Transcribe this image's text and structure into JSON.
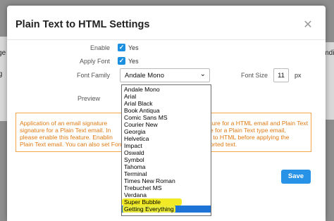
{
  "background": {
    "left_labels": [
      "ange",
      "ing"
    ],
    "right_label": "rmdi"
  },
  "modal": {
    "title": "Plain Text to HTML Settings",
    "close_icon": "close-icon",
    "enable": {
      "label": "Enable",
      "checkbox_label": "Yes",
      "checked": true
    },
    "apply_font": {
      "label": "Apply Font",
      "checkbox_label": "Yes",
      "checked": true
    },
    "font_family": {
      "label": "Font Family",
      "value": "Andale Mono"
    },
    "font_size": {
      "label": "Font Size",
      "value": "11",
      "unit": "px"
    },
    "preview_label": "Preview",
    "info_lines_left": [
      "Application of an email signature",
      "signature for a Plain Text email. In",
      "please enable this feature. Enablin",
      "Plain Text email. You can also set Fon"
    ],
    "info_lines_right": [
      "ture for a HTML email and Plain Text",
      "e for a Plain Text type email,",
      "l to HTML before applying the",
      "orted text."
    ],
    "save_label": "Save",
    "accent_color": "#2792e6",
    "warning_color": "#e07a12"
  },
  "font_dropdown": {
    "options": [
      "Andale Mono",
      "Arial",
      "Arial Black",
      "Book Antiqua",
      "Comic Sans MS",
      "Courier New",
      "Georgia",
      "Helvetica",
      "Impact",
      "Oswald",
      "Symbol",
      "Tahoma",
      "Terminal",
      "Times New Roman",
      "Trebuchet MS",
      "Verdana",
      "Super Bubble",
      "Getting Everything"
    ],
    "highlighted_option": "Super Bubble",
    "selected_option": "Getting Everything"
  }
}
